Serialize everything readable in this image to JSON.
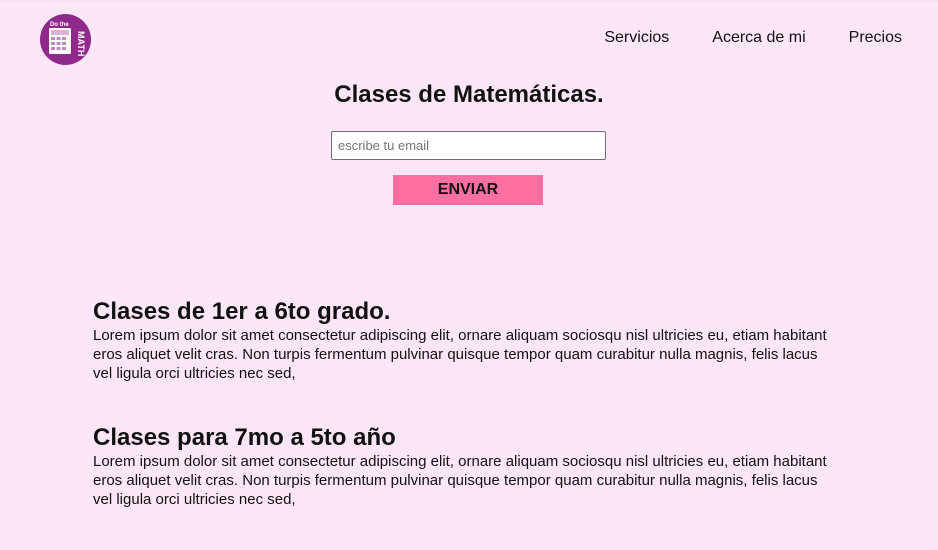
{
  "logo": {
    "line1": "Do the",
    "line2": "MATH",
    "icon": "calculator-icon",
    "color": "#8f2a8c"
  },
  "nav": {
    "items": [
      "Servicios",
      "Acerca de mi",
      "Precios"
    ]
  },
  "hero": {
    "title": "Clases de Matemáticas.",
    "email_placeholder": "escribe tu email",
    "email_value": "",
    "send_label": "ENVIAR",
    "button_color": "#ff6fa2"
  },
  "sections": [
    {
      "title": "Clases de 1er a 6to grado.",
      "body": "Lorem ipsum dolor sit amet consectetur adipiscing elit, ornare aliquam sociosqu nisl ultricies eu, etiam habitant eros aliquet velit cras. Non turpis fermentum pulvinar quisque tempor quam curabitur nulla magnis, felis lacus vel ligula orci ultricies nec sed,"
    },
    {
      "title": "Clases para 7mo a 5to año",
      "body": "Lorem ipsum dolor sit amet consectetur adipiscing elit, ornare aliquam sociosqu nisl ultricies eu, etiam habitant eros aliquet velit cras. Non turpis fermentum pulvinar quisque tempor quam curabitur nulla magnis, felis lacus vel ligula orci ultricies nec sed,"
    }
  ],
  "colors": {
    "background": "#fde6f8"
  }
}
